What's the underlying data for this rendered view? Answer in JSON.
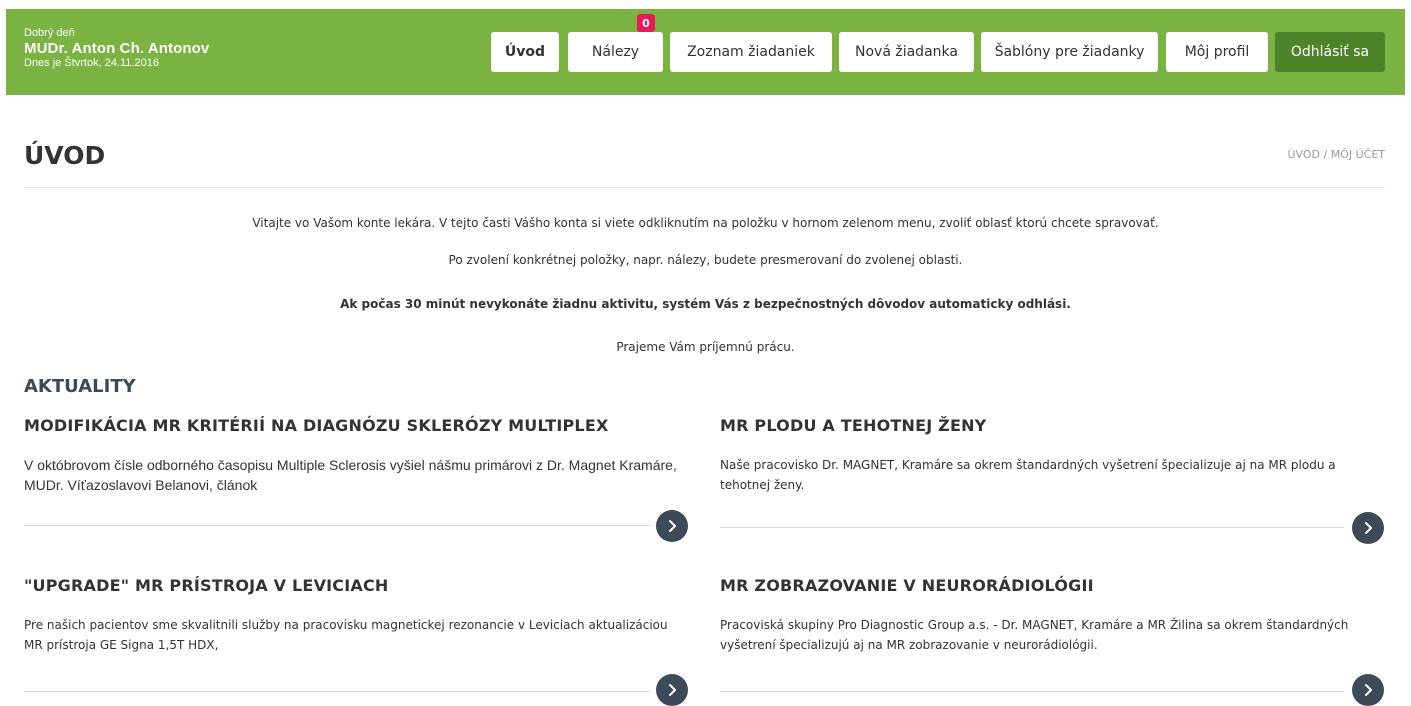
{
  "header": {
    "greeting": "Dobrý deň",
    "user_name": "MUDr. Anton Ch. Antonov",
    "date_text": "Dnes je Štvrtok, 24.11.2016",
    "background_color": "#7ab342"
  },
  "nav": {
    "items": [
      {
        "label": "Úvod"
      },
      {
        "label": "Nálezy"
      },
      {
        "label": "Zoznam žiadaniek"
      },
      {
        "label": "Nová žiadanka"
      },
      {
        "label": "Šablóny pre žiadanky"
      },
      {
        "label": "Môj profil"
      }
    ],
    "logout_label": "Odhlásiť sa",
    "nalezy_badge": "0",
    "badge_color": "#e8185a"
  },
  "page": {
    "title": "ÚVOD",
    "breadcrumb": "ÚVOD / MÔJ ÚČET"
  },
  "intro": {
    "line1": "Vitajte vo Vašom konte lekára. V tejto časti Vášho konta si viete odkliknutím na položku v hornom zelenom menu, zvoliť oblasť ktorú chcete spravovať.",
    "line2": "Po zvolení konkrétnej položky, napr. nálezy, budete presmerovaní do zvolenej oblasti.",
    "line3": "Ak počas 30 minút nevykonáte žiadnu aktivitu, systém Vás z bezpečnostných dôvodov automaticky odhlási.",
    "line4": "Prajeme Vám príjemnú prácu."
  },
  "news": {
    "section_title": "AKTUALITY",
    "items": [
      {
        "title": "MODIFIKÁCIA MR KRITÉRIÍ NA DIAGNÓZU SKLERÓZY MULTIPLEX",
        "text": "V októbrovom čísle odborného časopisu Multiple Sclerosis vyšiel nášmu primárovi z Dr. Magnet Kramáre, MUDr. Víťazoslavovi Belanovi, článok",
        "icon": "chevron-right-icon"
      },
      {
        "title": "MR PLODU A TEHOTNEJ ŽENY",
        "text": "Naše pracovisko Dr. MAGNET, Kramáre sa okrem štandardných vyšetrení špecializuje aj na MR plodu a tehotnej ženy.",
        "icon": "chevron-right-icon"
      },
      {
        "title": "\"UPGRADE\" MR PRÍSTROJA V LEVICIACH",
        "text": "Pre našich pacientov sme skvalitnili služby na pracovisku magnetickej rezonancie v Leviciach aktualizáciou MR prístroja GE Signa 1,5T HDX,",
        "icon": "chevron-right-icon"
      },
      {
        "title": "MR ZOBRAZOVANIE V NEURORÁDIOLÓGII",
        "text": "Pracoviská skupiny Pro Diagnostic Group a.s. -  Dr. MAGNET, Kramáre a MR Žilina  sa okrem štandardných vyšetrení špecializujú aj na MR zobrazovanie v neurorádiológii.",
        "icon": "chevron-right-icon"
      }
    ]
  }
}
